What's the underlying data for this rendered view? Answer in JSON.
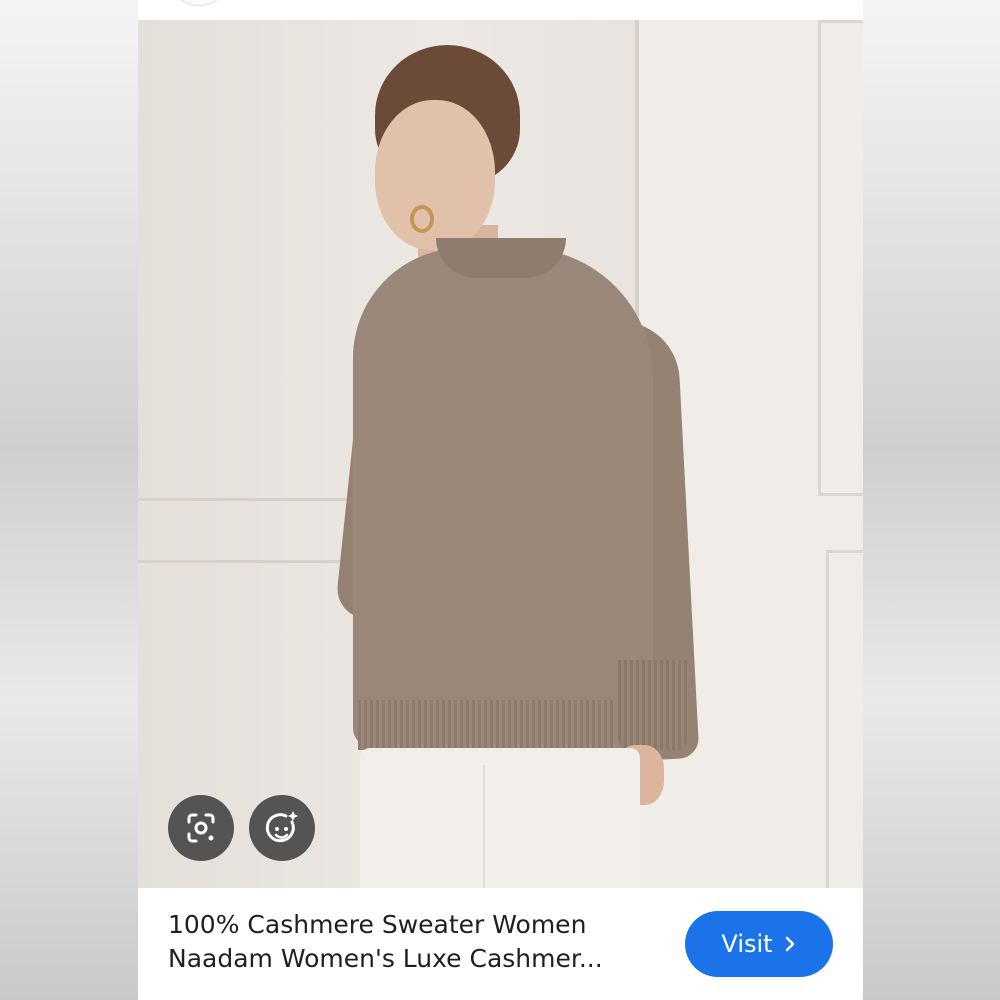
{
  "result": {
    "title_line1": "100% Cashmere Sweater Women",
    "title_line2": "Naadam Women's Luxe Cashmer...",
    "visit_label": "Visit"
  },
  "overlay_icons": [
    "google-lens-icon",
    "face-sparkle-icon"
  ],
  "colors": {
    "visit_button": "#1a73e8",
    "icon_button_bg": "#343434",
    "sweater": "#9a8779"
  }
}
